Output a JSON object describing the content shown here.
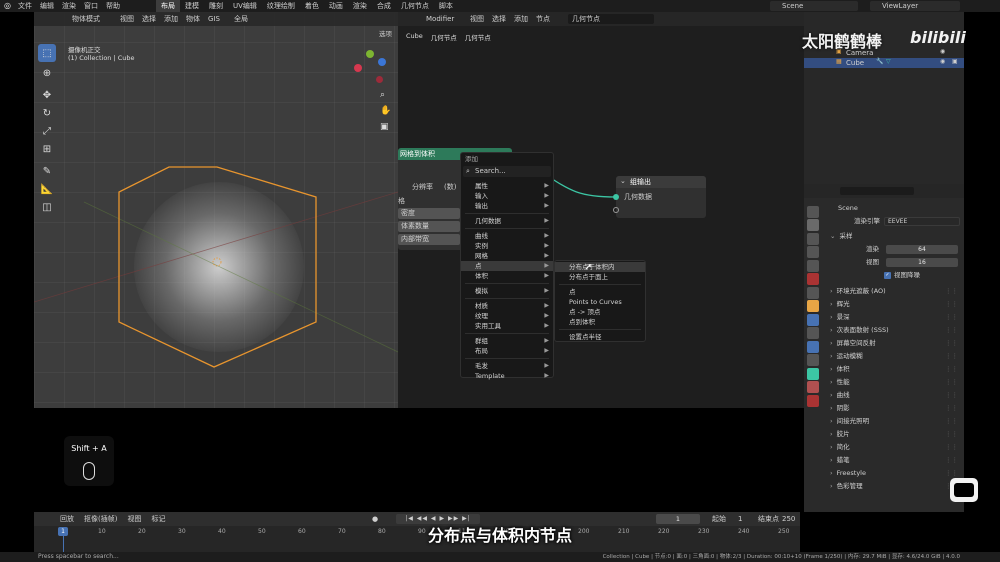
{
  "topbar": {
    "menus": [
      "文件",
      "编辑",
      "渲染",
      "窗口",
      "帮助"
    ],
    "workspaces": [
      "布局",
      "建模",
      "雕刻",
      "UV编辑",
      "纹理绘制",
      "着色",
      "动画",
      "渲染",
      "合成",
      "几何节点",
      "脚本"
    ],
    "active_workspace": "布局",
    "scene": "Scene",
    "view_layer": "ViewLayer"
  },
  "viewport": {
    "mode": "物体模式",
    "menus": [
      "视图",
      "选择",
      "添加",
      "物体",
      "GIS"
    ],
    "transform": "全局",
    "options_label": "选项",
    "view_name": "摄像机正交",
    "collection_label": "(1) Collection | Cube"
  },
  "node_editor": {
    "editor_type": "Modifier",
    "menus": [
      "视图",
      "选择",
      "添加",
      "节点"
    ],
    "node_group": "几何节点",
    "breadcrumb": [
      "Cube",
      "几何节点",
      "几何节点"
    ],
    "mesh_node": {
      "title": "网格到体积",
      "resolution_label": "分辨率",
      "resolution_value": "(数)",
      "grid_label": "格",
      "rows": [
        "密度",
        "体素数量",
        "内部带宽"
      ]
    },
    "output_node": {
      "title": "组输出",
      "socket": "几何数据"
    }
  },
  "add_menu": {
    "title": "添加",
    "search": "Search...",
    "groups": [
      [
        {
          "label": "属性",
          "sub": true
        },
        {
          "label": "输入",
          "sub": true
        },
        {
          "label": "输出",
          "sub": true
        }
      ],
      [
        {
          "label": "几何数据",
          "sub": true
        }
      ],
      [
        {
          "label": "曲线",
          "sub": true
        },
        {
          "label": "实例",
          "sub": true
        },
        {
          "label": "网格",
          "sub": true
        },
        {
          "label": "点",
          "sub": true,
          "hl": true
        },
        {
          "label": "体积",
          "sub": true
        }
      ],
      [
        {
          "label": "模拟",
          "sub": true
        }
      ],
      [
        {
          "label": "材质",
          "sub": true
        },
        {
          "label": "纹理",
          "sub": true
        },
        {
          "label": "实用工具",
          "sub": true
        }
      ],
      [
        {
          "label": "群组",
          "sub": true
        },
        {
          "label": "布局",
          "sub": true
        }
      ],
      [
        {
          "label": "毛发",
          "sub": true
        },
        {
          "label": "Template",
          "sub": true
        }
      ]
    ],
    "submenu": [
      [
        {
          "label": "分布点于体积内",
          "hl": true
        },
        {
          "label": "分布点于面上"
        }
      ],
      [
        {
          "label": "点"
        },
        {
          "label": "Points to Curves"
        },
        {
          "label": "点 -> 顶点"
        },
        {
          "label": "点到体积"
        }
      ],
      [
        {
          "label": "设置点半径"
        }
      ]
    ]
  },
  "outliner": {
    "items": [
      "Camera",
      "Cube"
    ]
  },
  "properties": {
    "scene_label": "Scene",
    "render_engine_label": "渲染引擎",
    "render_engine_value": "EEVEE",
    "sampling_label": "采样",
    "render_label": "渲染",
    "render_value": "64",
    "viewport_label": "视图",
    "viewport_value": "16",
    "denoise_label": "视图降噪",
    "panels": [
      "环境光遮蔽 (AO)",
      "辉光",
      "景深",
      "次表面散射 (SSS)",
      "屏幕空间反射",
      "运动模糊",
      "体积",
      "性能",
      "曲线",
      "阴影",
      "间接光照明",
      "胶片",
      "简化",
      "蜡笔",
      "Freestyle",
      "色彩管理"
    ]
  },
  "timeline": {
    "menus": [
      "回放",
      "抠像(插帧)",
      "视图",
      "标记"
    ],
    "current_frame": "1",
    "start_label": "起始",
    "start_value": "1",
    "end_label": "结束点",
    "end_value": "250",
    "ticks": [
      "1",
      "10",
      "20",
      "30",
      "40",
      "50",
      "60",
      "70",
      "80",
      "90",
      "110",
      "120",
      "190",
      "200",
      "210",
      "220",
      "230",
      "240",
      "250"
    ]
  },
  "statusbar": {
    "left": "Press spacebar to search...",
    "right": "Collection | Cube | 节点:0 | 面:0 | 三角面:0 | 物体:2/3 | Duration: 00:10+10 (Frame 1/250) | 内存: 29.7 MiB | 显存: 4.6/24.0 GiB | 4.0.0"
  },
  "overlay": {
    "shortcut": "Shift + A",
    "subtitle": "分布点与体积内节点",
    "watermark": "太阳鹤鹤棒"
  },
  "colors": {
    "accent": "#4772b3",
    "node_green": "#2d7a5a",
    "cube_outline": "#e8952e",
    "socket_cyan": "#3cc6a4"
  }
}
